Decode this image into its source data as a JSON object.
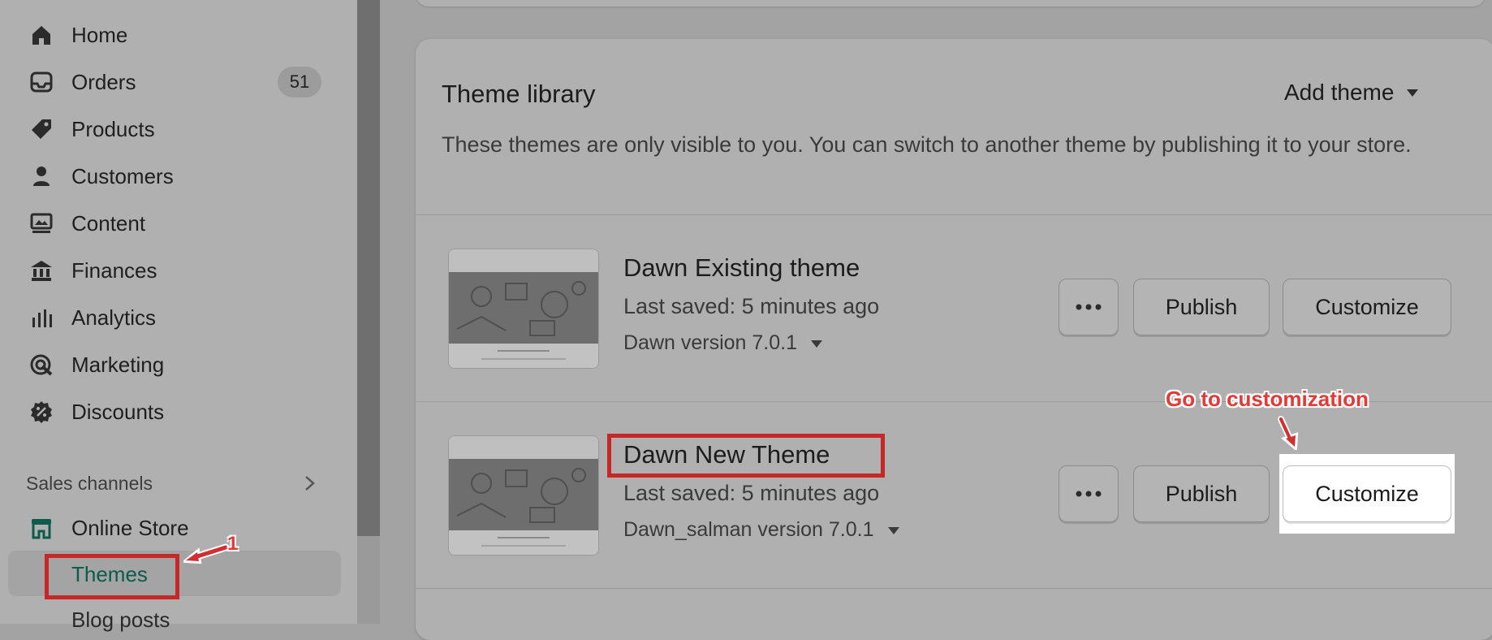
{
  "sidebar": {
    "items": [
      {
        "label": "Home",
        "icon": "home-icon"
      },
      {
        "label": "Orders",
        "icon": "orders-icon",
        "badge": "51"
      },
      {
        "label": "Products",
        "icon": "tag-icon"
      },
      {
        "label": "Customers",
        "icon": "person-icon"
      },
      {
        "label": "Content",
        "icon": "content-icon"
      },
      {
        "label": "Finances",
        "icon": "bank-icon"
      },
      {
        "label": "Analytics",
        "icon": "bar-chart-icon"
      },
      {
        "label": "Marketing",
        "icon": "marketing-icon"
      },
      {
        "label": "Discounts",
        "icon": "discount-icon"
      }
    ],
    "sales_channels_label": "Sales channels",
    "online_store_label": "Online Store",
    "themes_label": "Themes",
    "blog_posts_label": "Blog posts"
  },
  "theme_library": {
    "title": "Theme library",
    "add_theme_label": "Add theme",
    "description": "These themes are only visible to you. You can switch to another theme by publishing it to your store.",
    "themes": [
      {
        "name": "Dawn Existing theme",
        "last_saved": "Last saved: 5 minutes ago",
        "version": "Dawn version 7.0.1",
        "publish_label": "Publish",
        "customize_label": "Customize"
      },
      {
        "name": "Dawn New Theme",
        "last_saved": "Last saved: 5 minutes ago",
        "version": "Dawn_salman version 7.0.1",
        "publish_label": "Publish",
        "customize_label": "Customize"
      }
    ]
  },
  "annotations": {
    "go_to_customization": "Go to customization",
    "step_number": "1"
  },
  "colors": {
    "annotation_red": "#c62828",
    "online_store_green": "#0d5b4a",
    "overlay_gray": "#a3a3a3"
  }
}
